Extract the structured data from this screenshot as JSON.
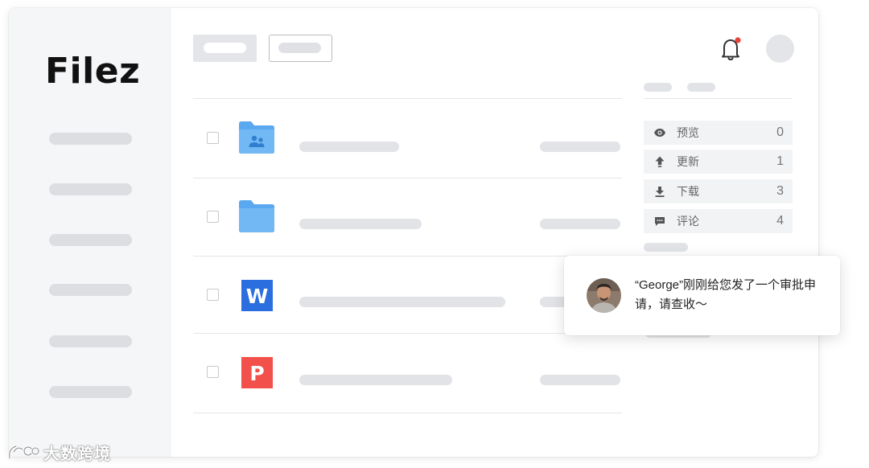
{
  "app": {
    "logo": "Filez"
  },
  "stats": [
    {
      "icon": "eye-icon",
      "label": "预览",
      "count": "0"
    },
    {
      "icon": "upload-arrow-icon",
      "label": "更新",
      "count": "1"
    },
    {
      "icon": "download-arrow-icon",
      "label": "下载",
      "count": "3"
    },
    {
      "icon": "comment-icon",
      "label": "评论",
      "count": "4"
    }
  ],
  "files": [
    {
      "type": "shared-folder"
    },
    {
      "type": "folder"
    },
    {
      "type": "word",
      "letter": "W"
    },
    {
      "type": "powerpoint",
      "letter": "P"
    }
  ],
  "notification": {
    "message": "“George”刚刚给您发了一个审批申请，请查收～"
  },
  "watermark": {
    "text": "大数跨境"
  },
  "colors": {
    "accent": "#5aa8ef",
    "word_blue": "#2a6ee0",
    "ppt_red": "#f2514b",
    "bell_dot": "#e8423a"
  }
}
